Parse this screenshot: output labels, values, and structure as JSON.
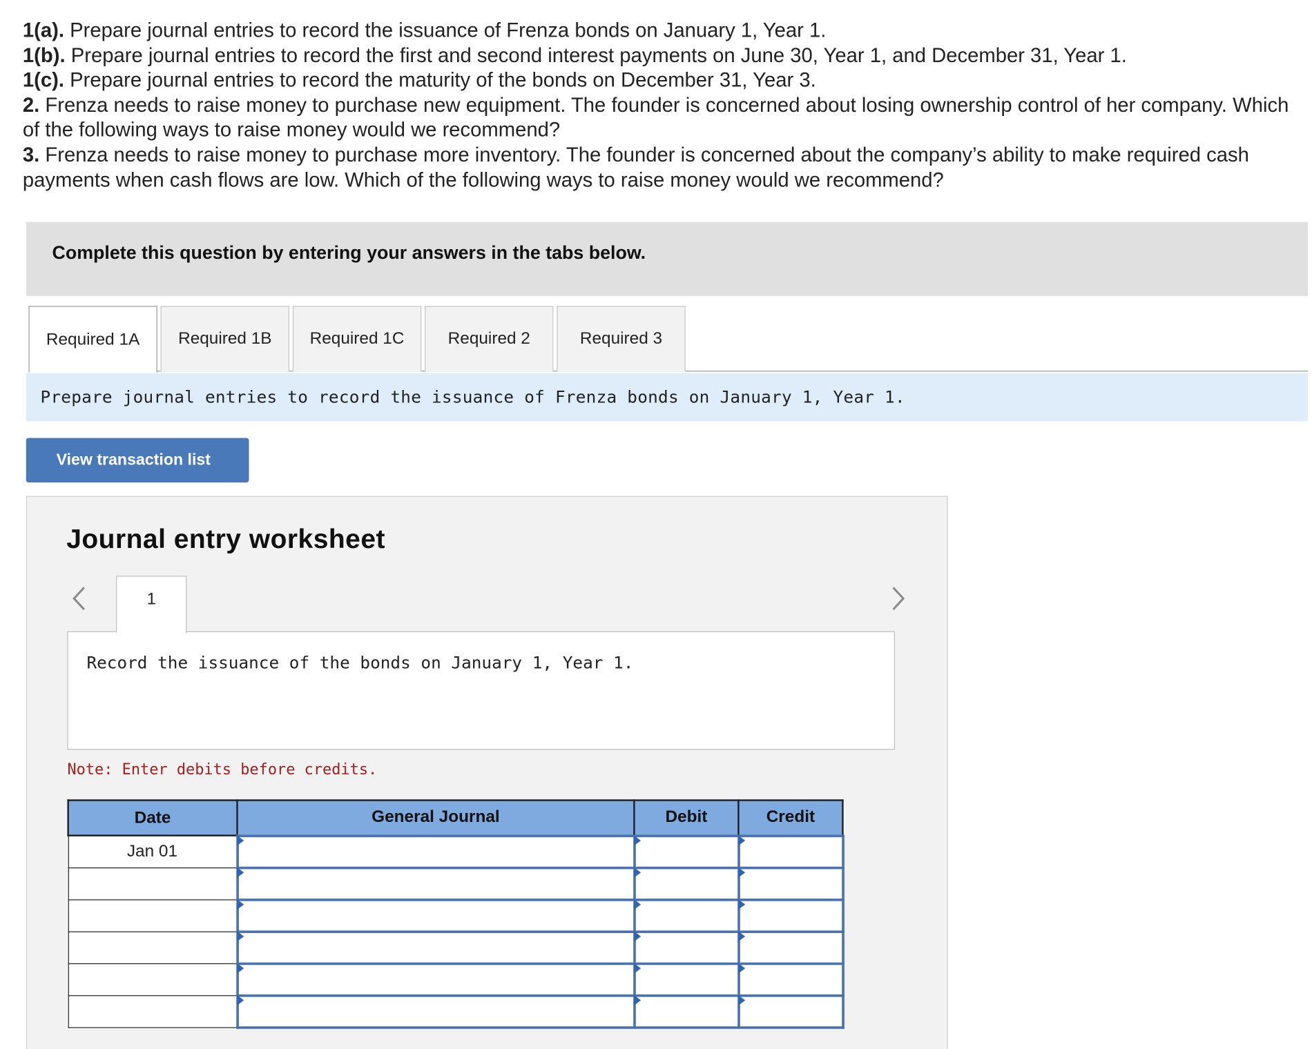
{
  "instructions": [
    {
      "label": "1(a).",
      "text": " Prepare journal entries to record the issuance of Frenza bonds on January 1, Year 1."
    },
    {
      "label": "1(b).",
      "text": " Prepare journal entries to record the first and second interest payments on June 30, Year 1, and December 31, Year 1."
    },
    {
      "label": "1(c).",
      "text": " Prepare journal entries to record the maturity of the bonds on December 31, Year 3."
    },
    {
      "label": "2.",
      "text": " Frenza needs to raise money to purchase new equipment. The founder is concerned about losing ownership control of her company. Which of the following ways to raise money would we recommend?"
    },
    {
      "label": "3.",
      "text": " Frenza needs to raise money to purchase more inventory. The founder is concerned about the company’s ability to make required cash payments when cash flows are low. Which of the following ways to raise money would we recommend?"
    }
  ],
  "banner": "Complete this question by entering your answers in the tabs below.",
  "tabs": [
    "Required 1A",
    "Required 1B",
    "Required 1C",
    "Required 2",
    "Required 3"
  ],
  "active_tab": "Required 1A",
  "prompt": "Prepare journal entries to record the issuance of Frenza bonds on January 1, Year 1.",
  "view_button": "View transaction list",
  "worksheet": {
    "title": "Journal entry worksheet",
    "entry_number": "1",
    "description": "Record the issuance of the bonds on January 1, Year 1.",
    "note": "Note: Enter debits before credits.",
    "columns": {
      "date": "Date",
      "general_journal": "General Journal",
      "debit": "Debit",
      "credit": "Credit"
    },
    "rows": [
      {
        "date": "Jan 01",
        "account": "",
        "debit": "",
        "credit": ""
      },
      {
        "date": "",
        "account": "",
        "debit": "",
        "credit": ""
      },
      {
        "date": "",
        "account": "",
        "debit": "",
        "credit": ""
      },
      {
        "date": "",
        "account": "",
        "debit": "",
        "credit": ""
      },
      {
        "date": "",
        "account": "",
        "debit": "",
        "credit": ""
      },
      {
        "date": "",
        "account": "",
        "debit": "",
        "credit": ""
      }
    ]
  },
  "icons": {
    "prev": "chevron-left-icon",
    "next": "chevron-right-icon"
  },
  "colors": {
    "button": "#4a79b9",
    "table_header": "#7faae0",
    "note": "#a32020",
    "prompt_bg": "#dfecf9"
  }
}
